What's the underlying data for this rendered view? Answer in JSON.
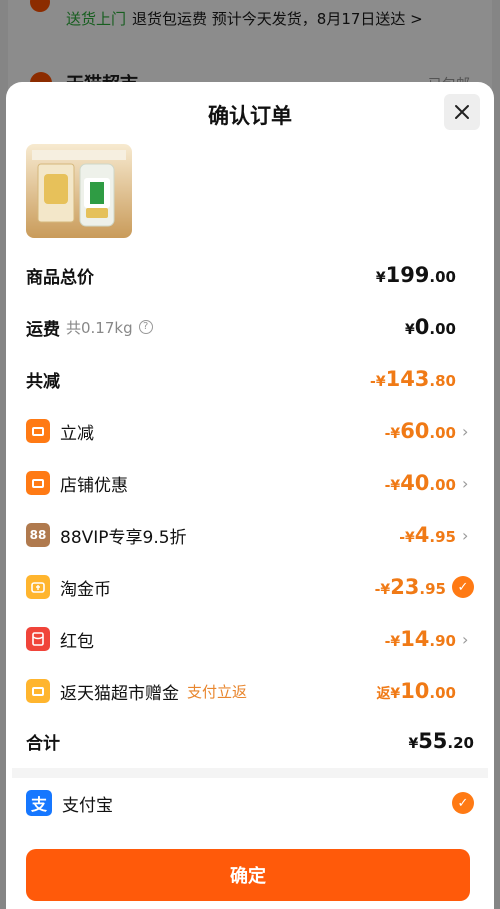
{
  "background": {
    "shipping_tag": "送货上门",
    "shipping_info": "退货包运费 预计今天发货，8月17日送达 >",
    "store_name": "天猫超市",
    "right_text": "已包邮"
  },
  "sheet": {
    "title": "确认订单",
    "product_image": "product-thumbnail",
    "subtotal": {
      "label": "商品总价",
      "currency": "¥",
      "integer": "199",
      "decimal": ".00"
    },
    "shipping": {
      "label": "运费",
      "weight": "共0.17kg",
      "currency": "¥",
      "integer": "0",
      "decimal": ".00"
    },
    "total_discount": {
      "label": "共减",
      "prefix": "-¥",
      "integer": "143",
      "decimal": ".80"
    },
    "discounts": [
      {
        "label": "立减",
        "prefix": "-¥",
        "integer": "60",
        "decimal": ".00",
        "icon": "coupon-icon",
        "trailing": "chevron"
      },
      {
        "label": "店铺优惠",
        "prefix": "-¥",
        "integer": "40",
        "decimal": ".00",
        "icon": "store-coupon-icon",
        "trailing": "chevron"
      },
      {
        "label": "88VIP专享9.5折",
        "prefix": "-¥",
        "integer": "4",
        "decimal": ".95",
        "icon": "vip88-icon",
        "badge": "88",
        "trailing": "chevron"
      },
      {
        "label": "淘金币",
        "prefix": "-¥",
        "integer": "23",
        "decimal": ".95",
        "icon": "taojinbi-icon",
        "trailing": "check"
      },
      {
        "label": "红包",
        "prefix": "-¥",
        "integer": "14",
        "decimal": ".90",
        "icon": "red-packet-icon",
        "trailing": "chevron"
      }
    ],
    "cashback": {
      "label": "返天猫超市赠金",
      "sub": "支付立返",
      "prefix": "返¥",
      "integer": "10",
      "decimal": ".00"
    },
    "total": {
      "label": "合计",
      "currency": "¥",
      "integer": "55",
      "decimal": ".20"
    },
    "payment": {
      "label": "支付宝",
      "icon_glyph": "支"
    },
    "confirm_label": "确定"
  },
  "colors": {
    "accent": "#ff5a0a",
    "discount": "#f07a16",
    "alipay": "#1677ff",
    "green": "#2bab3a"
  }
}
